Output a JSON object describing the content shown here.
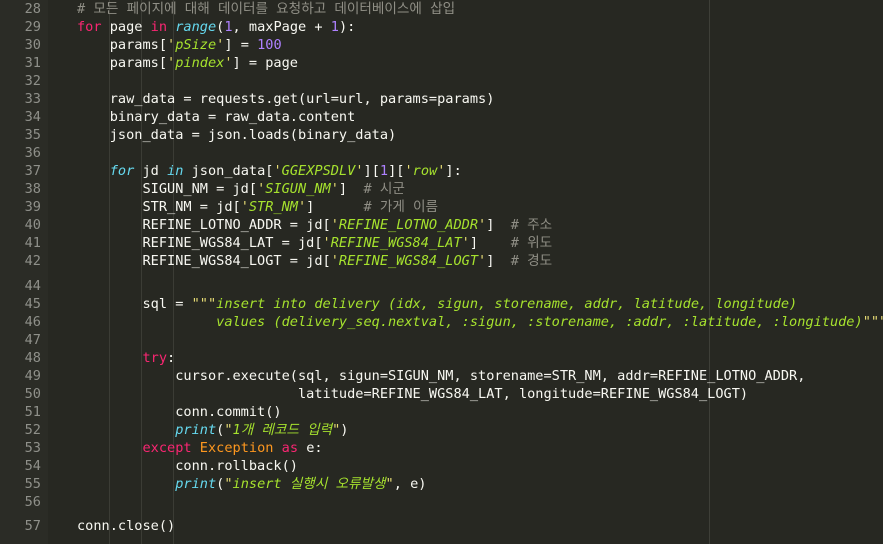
{
  "editor": {
    "lines": [
      {
        "n": "28",
        "segs": [
          {
            "t": "# 모든 페이지에 대해 데이터를 요청하고 데이터베이스에 삽입",
            "c": "cm"
          }
        ]
      },
      {
        "n": "29",
        "segs": [
          {
            "t": "for",
            "c": "ctl"
          },
          {
            "t": " page "
          },
          {
            "t": "in",
            "c": "ctl"
          },
          {
            "t": " "
          },
          {
            "t": "range",
            "c": "kw"
          },
          {
            "t": "("
          },
          {
            "t": "1",
            "c": "num"
          },
          {
            "t": ", maxPage + "
          },
          {
            "t": "1",
            "c": "num"
          },
          {
            "t": "):"
          }
        ]
      },
      {
        "n": "30",
        "segs": [
          {
            "t": "    params["
          },
          {
            "t": "'",
            "c": "str"
          },
          {
            "t": "pSize",
            "c": "sk"
          },
          {
            "t": "'",
            "c": "str"
          },
          {
            "t": "] = "
          },
          {
            "t": "100",
            "c": "num"
          }
        ]
      },
      {
        "n": "31",
        "segs": [
          {
            "t": "    params["
          },
          {
            "t": "'",
            "c": "str"
          },
          {
            "t": "pindex",
            "c": "sk"
          },
          {
            "t": "'",
            "c": "str"
          },
          {
            "t": "] = page"
          }
        ]
      },
      {
        "n": "32",
        "segs": []
      },
      {
        "n": "33",
        "segs": [
          {
            "t": "    raw_data = requests.get(url=url, params=params)"
          }
        ]
      },
      {
        "n": "34",
        "segs": [
          {
            "t": "    binary_data = raw_data.content"
          }
        ]
      },
      {
        "n": "35",
        "segs": [
          {
            "t": "    json_data = json.loads(binary_data)"
          }
        ]
      },
      {
        "n": "36",
        "segs": []
      },
      {
        "n": "37",
        "segs": [
          {
            "t": "    "
          },
          {
            "t": "for",
            "c": "kw"
          },
          {
            "t": " jd "
          },
          {
            "t": "in",
            "c": "kw"
          },
          {
            "t": " json_data["
          },
          {
            "t": "'",
            "c": "str"
          },
          {
            "t": "GGEXPSDLV",
            "c": "sk"
          },
          {
            "t": "'",
            "c": "str"
          },
          {
            "t": "]["
          },
          {
            "t": "1",
            "c": "num"
          },
          {
            "t": "]["
          },
          {
            "t": "'",
            "c": "str"
          },
          {
            "t": "row",
            "c": "sk"
          },
          {
            "t": "'",
            "c": "str"
          },
          {
            "t": "]:"
          }
        ]
      },
      {
        "n": "38",
        "segs": [
          {
            "t": "        SIGUN_NM = jd["
          },
          {
            "t": "'",
            "c": "str"
          },
          {
            "t": "SIGUN_NM",
            "c": "sk"
          },
          {
            "t": "'",
            "c": "str"
          },
          {
            "t": "]  "
          },
          {
            "t": "# 시군",
            "c": "cm"
          }
        ]
      },
      {
        "n": "39",
        "segs": [
          {
            "t": "        STR_NM = jd["
          },
          {
            "t": "'",
            "c": "str"
          },
          {
            "t": "STR_NM",
            "c": "sk"
          },
          {
            "t": "'",
            "c": "str"
          },
          {
            "t": "]      "
          },
          {
            "t": "# 가게 이름",
            "c": "cm"
          }
        ]
      },
      {
        "n": "40",
        "segs": [
          {
            "t": "        REFINE_LOTNO_ADDR = jd["
          },
          {
            "t": "'",
            "c": "str"
          },
          {
            "t": "REFINE_LOTNO_ADDR",
            "c": "sk"
          },
          {
            "t": "'",
            "c": "str"
          },
          {
            "t": "]  "
          },
          {
            "t": "# 주소",
            "c": "cm"
          }
        ]
      },
      {
        "n": "41",
        "segs": [
          {
            "t": "        REFINE_WGS84_LAT = jd["
          },
          {
            "t": "'",
            "c": "str"
          },
          {
            "t": "REFINE_WGS84_LAT",
            "c": "sk"
          },
          {
            "t": "'",
            "c": "str"
          },
          {
            "t": "]    "
          },
          {
            "t": "# 위도",
            "c": "cm"
          }
        ]
      },
      {
        "n": "42",
        "segs": [
          {
            "t": "        REFINE_WGS84_LOGT = jd["
          },
          {
            "t": "'",
            "c": "str"
          },
          {
            "t": "REFINE_WGS84_LOGT",
            "c": "sk"
          },
          {
            "t": "'",
            "c": "str"
          },
          {
            "t": "]  "
          },
          {
            "t": "# 경도",
            "c": "cm"
          }
        ]
      },
      {
        "n": "44",
        "segs": []
      },
      {
        "n": "45",
        "segs": [
          {
            "t": "        sql = "
          },
          {
            "t": "\"\"\"",
            "c": "str"
          },
          {
            "t": "insert into delivery (idx, sigun, storename, addr, latitude, longitude)",
            "c": "mlstr"
          }
        ]
      },
      {
        "n": "46",
        "segs": [
          {
            "t": "                 values (delivery_seq.nextval, :sigun, :storename, :addr, :latitude, :longitude)",
            "c": "mlstr"
          },
          {
            "t": "\"\"\"",
            "c": "str"
          }
        ]
      },
      {
        "n": "47",
        "segs": []
      },
      {
        "n": "48",
        "segs": [
          {
            "t": "        "
          },
          {
            "t": "try",
            "c": "ctl"
          },
          {
            "t": ":"
          }
        ]
      },
      {
        "n": "49",
        "segs": [
          {
            "t": "            cursor.execute(sql, sigun=SIGUN_NM, storename=STR_NM, addr=REFINE_LOTNO_ADDR,"
          }
        ]
      },
      {
        "n": "50",
        "segs": [
          {
            "t": "                           latitude=REFINE_WGS84_LAT, longitude=REFINE_WGS84_LOGT)"
          }
        ]
      },
      {
        "n": "51",
        "segs": [
          {
            "t": "            conn.commit()"
          }
        ]
      },
      {
        "n": "52",
        "segs": [
          {
            "t": "            "
          },
          {
            "t": "print",
            "c": "kw"
          },
          {
            "t": "("
          },
          {
            "t": "\"",
            "c": "str"
          },
          {
            "t": "1개 레코드 입력",
            "c": "mlstr"
          },
          {
            "t": "\"",
            "c": "str"
          },
          {
            "t": ")"
          }
        ]
      },
      {
        "n": "53",
        "segs": [
          {
            "t": "        "
          },
          {
            "t": "except",
            "c": "ctl"
          },
          {
            "t": " "
          },
          {
            "t": "Exception",
            "c": "exc"
          },
          {
            "t": " "
          },
          {
            "t": "as",
            "c": "ctl"
          },
          {
            "t": " e:"
          }
        ]
      },
      {
        "n": "54",
        "segs": [
          {
            "t": "            conn.rollback()"
          }
        ]
      },
      {
        "n": "55",
        "segs": [
          {
            "t": "            "
          },
          {
            "t": "print",
            "c": "kw"
          },
          {
            "t": "("
          },
          {
            "t": "\"",
            "c": "str"
          },
          {
            "t": "insert 실행시 오류발생",
            "c": "mlstr"
          },
          {
            "t": "\"",
            "c": "str"
          },
          {
            "t": ", e)"
          }
        ]
      },
      {
        "n": "56",
        "segs": []
      },
      {
        "n": "57",
        "segs": [
          {
            "t": "conn.close()"
          }
        ]
      }
    ]
  }
}
